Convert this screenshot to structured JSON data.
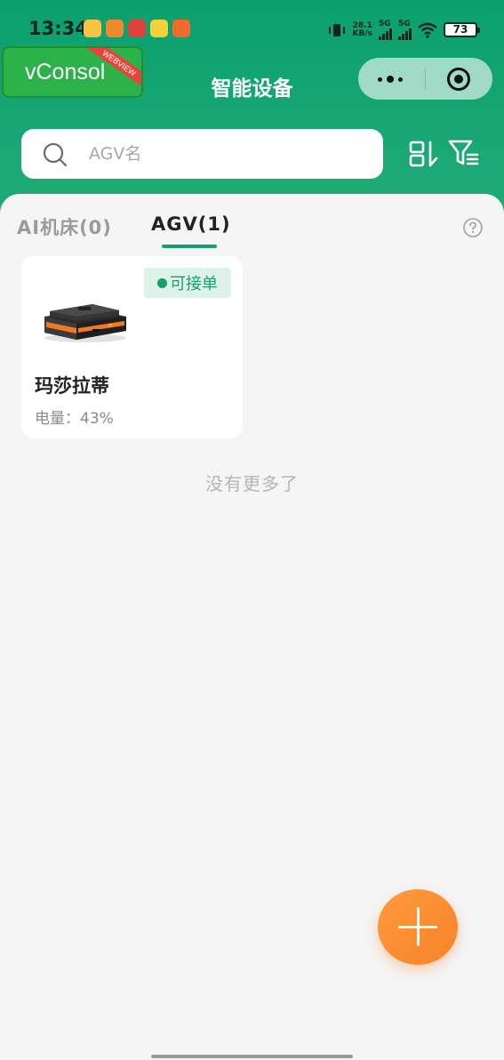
{
  "status_bar": {
    "time": "13:34",
    "net_speed_value": "28.1",
    "net_speed_unit": "KB/s",
    "signal_1": "5G",
    "signal_2": "5G",
    "battery": "73"
  },
  "debug": {
    "vconsole_label": "vConsol",
    "ribbon": "WEBVIEW"
  },
  "header": {
    "title": "智能设备"
  },
  "search": {
    "placeholder": "AGV名",
    "value": ""
  },
  "tabs": [
    {
      "label": "AI机床(0)",
      "active": false
    },
    {
      "label": "AGV(1)",
      "active": true
    }
  ],
  "devices": [
    {
      "status": "可接单",
      "name": "玛莎拉蒂",
      "battery_label": "电量：",
      "battery_value": "43%"
    }
  ],
  "list_end_text": "没有更多了",
  "colors": {
    "primary_green": "#13a06d",
    "fab_orange": "#f7822a",
    "background": "#f5f5f5"
  }
}
